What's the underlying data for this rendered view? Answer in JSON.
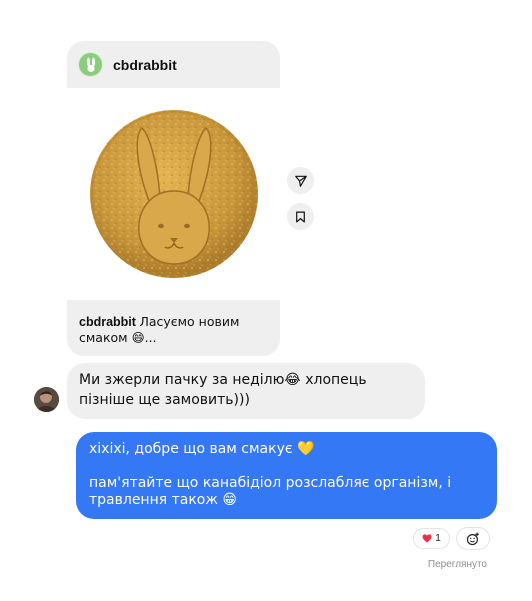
{
  "shared_post": {
    "author": "cbdrabbit",
    "caption_author": "cbdrabbit",
    "caption_text": "Ласуємо новим смаком 😄..."
  },
  "messages": {
    "incoming_text": "Ми зжерли пачку за неділю😂 хлопець пізніше ще замовить)))",
    "outgoing_line1": "хіхіхі, добре що вам смакує 💛",
    "outgoing_line2": "пам'ятайте що канабідіол розслабляє організм, і травлення також 😁"
  },
  "reactions": {
    "emoji": "❤️",
    "count": "1"
  },
  "status": {
    "seen_label": "Переглянуто"
  },
  "colors": {
    "outgoing_bubble": "#3478f6",
    "incoming_bubble": "#efefef",
    "avatar_green": "#8ccd7d"
  },
  "icons": [
    "bunny-logo-icon",
    "paper-plane-icon",
    "bookmark-icon",
    "smiley-plus-icon",
    "heart-icon"
  ]
}
